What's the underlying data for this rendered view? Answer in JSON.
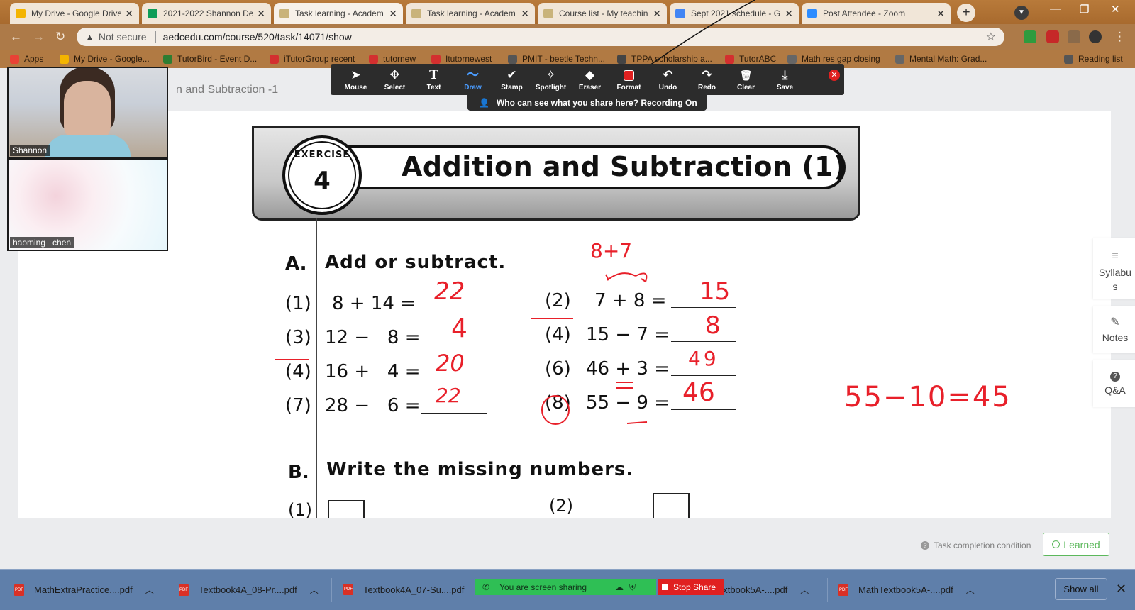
{
  "browser": {
    "tabs": [
      {
        "title": "My Drive - Google Drive",
        "favicon_color": "#f4b400",
        "active": false
      },
      {
        "title": "2021-2022 Shannon De",
        "favicon_color": "#0f9d58",
        "active": false
      },
      {
        "title": "Task learning - Academ",
        "favicon_color": "#c9b37a",
        "active": true
      },
      {
        "title": "Task learning - Academ",
        "favicon_color": "#c9b37a",
        "active": false
      },
      {
        "title": "Course list - My teachin",
        "favicon_color": "#c9b37a",
        "active": false
      },
      {
        "title": "Sept 2021 schedule - G",
        "favicon_color": "#4285f4",
        "active": false
      },
      {
        "title": "Post Attendee - Zoom",
        "favicon_color": "#2d8cff",
        "active": false
      }
    ],
    "new_tab_label": "+",
    "close_label": "✕",
    "security_label": "Not secure",
    "url": "aedcedu.com/course/520/task/14071/show",
    "bookmarks": [
      {
        "label": "Apps",
        "color": "#e94235"
      },
      {
        "label": "My Drive - Google...",
        "color": "#f4b400"
      },
      {
        "label": "TutorBird - Event D...",
        "color": "#2e7d32"
      },
      {
        "label": "iTutorGroup recent",
        "color": "#d32f2f"
      },
      {
        "label": "tutornew",
        "color": "#d32f2f"
      },
      {
        "label": "Itutornewest",
        "color": "#d32f2f"
      },
      {
        "label": "PMIT - beetle Techn...",
        "color": "#555555"
      },
      {
        "label": "TPPA scholarship a...",
        "color": "#444444"
      },
      {
        "label": "TutorABC",
        "color": "#d32f2f"
      },
      {
        "label": "Math res gap closing",
        "color": "#666666"
      },
      {
        "label": "Mental Math: Grad...",
        "color": "#666666"
      },
      {
        "label": "Reading list",
        "color": "#555555"
      }
    ]
  },
  "zoom": {
    "tools": [
      {
        "label": "Mouse",
        "icon": "➤"
      },
      {
        "label": "Select",
        "icon": "✥"
      },
      {
        "label": "Text",
        "icon": "T"
      },
      {
        "label": "Draw",
        "icon": "〜"
      },
      {
        "label": "Stamp",
        "icon": "✔"
      },
      {
        "label": "Spotlight",
        "icon": "✧"
      },
      {
        "label": "Eraser",
        "icon": "◆"
      },
      {
        "label": "Format",
        "icon": ""
      },
      {
        "label": "Undo",
        "icon": "↶"
      },
      {
        "label": "Redo",
        "icon": "↷"
      },
      {
        "label": "Clear",
        "icon": "🗑"
      },
      {
        "label": "Save",
        "icon": "⤓"
      }
    ],
    "selected_tool": "Draw",
    "recording_notice": "Who can see what you share here? Recording On",
    "participants": [
      {
        "name": "Shannon"
      },
      {
        "name": "haoming   chen"
      }
    ],
    "sharing_label": "You are screen sharing",
    "stop_share_label": "Stop Share"
  },
  "course_page": {
    "lesson_title_fragment": "n and Subtraction -1",
    "side_buttons": [
      {
        "label": "Syllabus",
        "icon": "≡"
      },
      {
        "label": "Notes",
        "icon": "✎"
      },
      {
        "label": "Q&A",
        "icon": "?"
      }
    ],
    "task_completion_label": "Task completion condition",
    "learned_label": "Learned"
  },
  "worksheet": {
    "exercise_badge_word": "EXERCISE",
    "exercise_number": "4",
    "title": "Addition and Subtraction (1)",
    "section_a_letter": "A.",
    "section_a_label": "Add or subtract.",
    "section_b_letter": "B.",
    "section_b_label": "Write the missing numbers.",
    "problems_left": [
      {
        "num": "(1)",
        "expr": "8 + 14 =",
        "answer": "22"
      },
      {
        "num": "(3)",
        "expr": "12 −   8 =",
        "answer": "4"
      },
      {
        "num": "(4)",
        "expr": "16 +   4 =",
        "answer": "20"
      },
      {
        "num": "(7)",
        "expr": "28 −   6 =",
        "answer": "22"
      }
    ],
    "problems_right": [
      {
        "num": "(2)",
        "expr": "7 + 8 =",
        "answer": "15"
      },
      {
        "num": "(4)",
        "expr": "15 − 7 =",
        "answer": "8"
      },
      {
        "num": "(6)",
        "expr": "46 + 3 =",
        "answer": "49"
      },
      {
        "num": "(8)",
        "expr": "55 − 9 =",
        "answer": "46"
      }
    ],
    "b_items": [
      "(1)",
      "(2)"
    ],
    "annotations": {
      "swap_note": "8+7",
      "side_calc": "55−10=45"
    }
  },
  "downloads": [
    {
      "name": "MathExtraPractice....pdf"
    },
    {
      "name": "Textbook4A_08-Pr....pdf"
    },
    {
      "name": "Textbook4A_07-Su....pdf"
    },
    {
      "name": "extbook5A-....pdf"
    },
    {
      "name": "MathTextbook5A-....pdf"
    }
  ],
  "downloads_show_all": "Show all",
  "colors": {
    "annotation_red": "#e8202a",
    "learned_green": "#5cb85c",
    "share_green": "#2fbf55",
    "stop_red": "#e02020"
  }
}
